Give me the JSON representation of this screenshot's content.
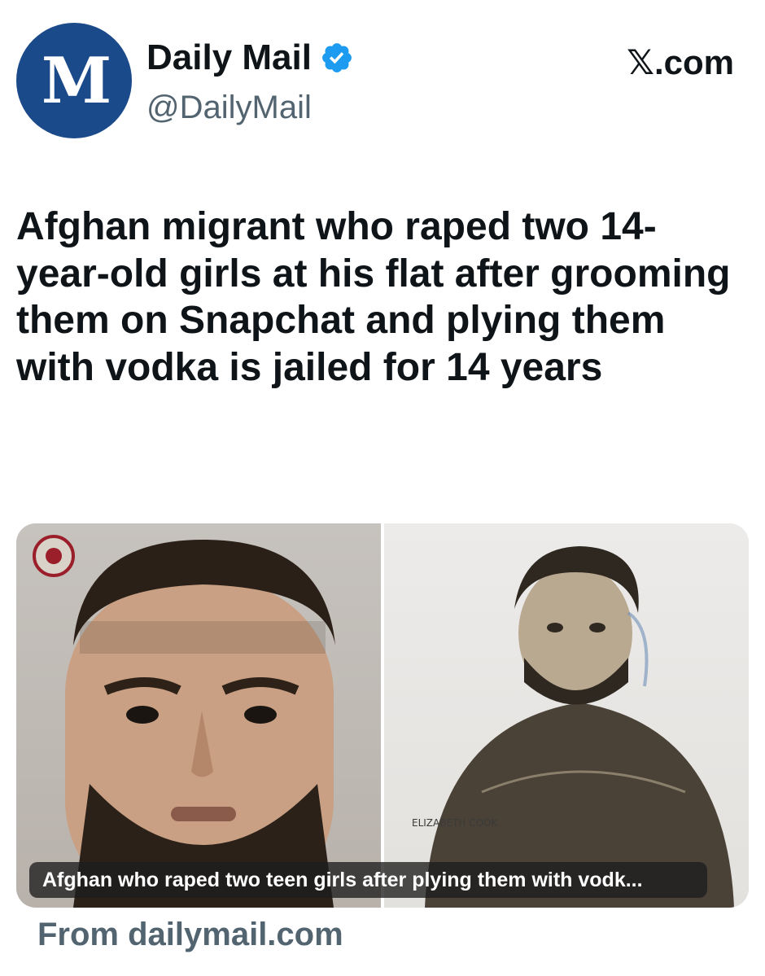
{
  "account": {
    "avatar_letters": "M",
    "display_name": "Daily Mail",
    "handle": "@DailyMail",
    "site": "𝕏.com"
  },
  "post": {
    "headline": "Afghan migrant who raped two 14-year-old girls at his flat after grooming them on Snapchat and plying them with vodka is jailed for 14 years"
  },
  "card": {
    "sketch_signature": "ELIZABETH COOK",
    "caption": "Afghan who raped two teen girls after plying them with vodk...",
    "source": "From dailymail.com"
  },
  "colors": {
    "avatar_bg": "#1a4a8a",
    "verified_blue": "#1d9bf0",
    "muted_text": "#536471"
  }
}
